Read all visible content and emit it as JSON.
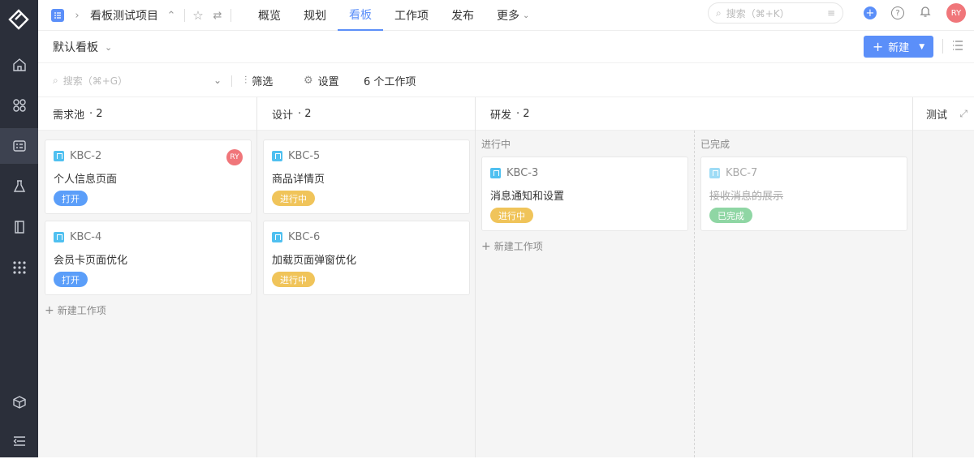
{
  "project": {
    "name": "看板测试项目"
  },
  "nav": {
    "tabs": [
      "概览",
      "规划",
      "看板",
      "工作项",
      "发布",
      "更多"
    ],
    "active": "看板"
  },
  "search_top": {
    "placeholder": "搜索（⌘+K）"
  },
  "user": {
    "initials": "RY"
  },
  "board_selector": {
    "label": "默认看板"
  },
  "new_button": {
    "label": "新建"
  },
  "filter": {
    "search_placeholder": "搜索（⌘+G）",
    "filter_label": "筛选",
    "settings_label": "设置",
    "count_label": "6 个工作项"
  },
  "columns": [
    {
      "name": "需求池",
      "count": "· 2"
    },
    {
      "name": "设计",
      "count": "· 2"
    },
    {
      "name": "研发",
      "count": "· 2"
    },
    {
      "name": "测试"
    }
  ],
  "subcolumns": {
    "in_progress": "进行中",
    "done": "已完成"
  },
  "cards": {
    "kbc2": {
      "id": "KBC-2",
      "title": "个人信息页面",
      "status": "打开",
      "assignee": "RY"
    },
    "kbc4": {
      "id": "KBC-4",
      "title": "会员卡页面优化",
      "status": "打开"
    },
    "kbc5": {
      "id": "KBC-5",
      "title": "商品详情页",
      "status": "进行中"
    },
    "kbc6": {
      "id": "KBC-6",
      "title": "加载页面弹窗优化",
      "status": "进行中"
    },
    "kbc3": {
      "id": "KBC-3",
      "title": "消息通知和设置",
      "status": "进行中"
    },
    "kbc7": {
      "id": "KBC-7",
      "title": "接收消息的展示",
      "status": "已完成"
    }
  },
  "add_new_label": "新建工作项",
  "colors": {
    "accent": "#5b8ff9",
    "open": "#5b9ef9",
    "in_progress": "#f0c45a",
    "done": "#8fd6a4",
    "avatar": "#f0767a"
  }
}
